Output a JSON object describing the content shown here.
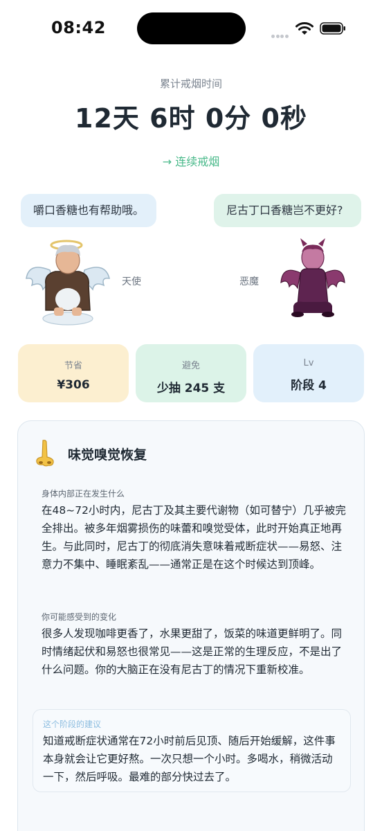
{
  "status_bar": {
    "time": "08:42"
  },
  "header": {
    "subtitle": "累计戒烟时间",
    "timer": "12天 6时 0分 0秒",
    "continue_link": "→ 连续戒烟"
  },
  "angel": {
    "bubble": "嚼口香糖也有帮助哦。",
    "label": "天使"
  },
  "devil": {
    "bubble": "尼古丁口香糖岂不更好?",
    "label": "恶魔"
  },
  "stats": [
    {
      "label": "节省",
      "value": "¥306"
    },
    {
      "label": "避免",
      "value": "少抽 245 支"
    },
    {
      "label": "Lv",
      "value": "阶段 4"
    }
  ],
  "info_card": {
    "title": "味觉嗅觉恢复",
    "section1": {
      "label": "身体内部正在发生什么",
      "text": "在48~72小时内，尼古丁及其主要代谢物（如可替宁）几乎被完全排出。被多年烟雾损伤的味蕾和嗅觉受体，此时开始真正地再生。与此同时，尼古丁的彻底消失意味着戒断症状——易怒、注意力不集中、睡眠紊乱——通常正是在这个时候达到顶峰。"
    },
    "section2": {
      "label": "你可能感受到的变化",
      "text": "很多人发现咖啡更香了，水果更甜了，饭菜的味道更鲜明了。同时情绪起伏和易怒也很常见——这是正常的生理反应，不是出了什么问题。你的大脑正在没有尼古丁的情况下重新校准。"
    },
    "advice": {
      "label": "这个阶段的建议",
      "text": "知道戒断症状通常在72小时前后见顶、随后开始缓解，这件事本身就会让它更好熬。一次只想一个小时。多喝水，稍微活动一下，然后呼吸。最难的部分快过去了。"
    }
  },
  "colors": {
    "accent_green": "#49b98a",
    "save_bg": "#fcefd0",
    "avoid_bg": "#dcf3e8",
    "lv_bg": "#e2f0fb"
  }
}
